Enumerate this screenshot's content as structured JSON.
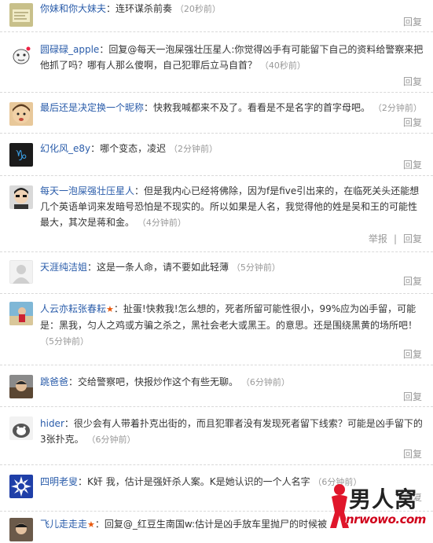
{
  "comments": [
    {
      "user": "你妹和你大妹夫",
      "text": "：连环谋杀前奏",
      "time": "（20秒前）",
      "actions": [
        "回复"
      ]
    },
    {
      "user": "圆碌碌_apple",
      "text": "：回复@每天一泡屎强壮压星人:你觉得凶手有可能留下自己的资料给警察来把他抓了吗？哪有人那么傻啊，自己犯罪后立马自首？",
      "time": "（40秒前）",
      "actions": [
        "回复"
      ]
    },
    {
      "user": "最后还是决定换一个昵称",
      "text": "：快救我喊都来不及了。看看是不是名字的首字母吧。",
      "time": "（2分钟前）",
      "actions": [
        "回复"
      ]
    },
    {
      "user": "幻化风_e8y",
      "text": "：哪个变态，凌迟",
      "time": "（2分钟前）",
      "actions": [
        "回复"
      ]
    },
    {
      "user": "每天一泡屎强壮压星人",
      "text": "：但是我内心已经将佛除，因为f是five引出来的，在临死关头还能想几个英语单词来发暗号恐怕是不现实的。所以如果是人名，我觉得他的姓是吴和王的可能性最大，其次是蒋和金。",
      "time": "（4分钟前）",
      "actions": [
        "举报",
        "回复"
      ]
    },
    {
      "user": "天涯纯洁姐",
      "text": "：这是一条人命，请不要如此轻薄",
      "time": "（5分钟前）",
      "actions": [
        "回复"
      ]
    },
    {
      "user": "人云亦耘张春耘",
      "text": "：扯蛋!快救我!怎么想的，死者所留可能性很小，99%应为凶手留，可能是：黑我，匀人之鸡或方骗之杀之，黑社会老大或黑王。的意思。还是围绕黑黄的场所吧！",
      "time": "（5分钟前）",
      "actions": [
        "回复"
      ]
    },
    {
      "user": "跳爸爸",
      "text": "：交给警察吧，快报炒作这个有些无聊。",
      "time": "（6分钟前）",
      "actions": [
        "回复"
      ]
    },
    {
      "user": "hider",
      "text": "：很少会有人带着扑克出街的，而且犯罪者没有发现死者留下线索？可能是凶手留下的3张扑克。",
      "time": "（6分钟前）",
      "actions": [
        "回复"
      ]
    },
    {
      "user": "四明老叟",
      "text": "：K奸 我，估计是强奸杀人案。K是她认识的一个人名字",
      "time": "（6分钟前）",
      "actions": [
        "回复"
      ]
    },
    {
      "user": "飞儿走走走",
      "text": "：回复@_红豆生南国w:估计是凶手放车里抛尸的时候被",
      "time": "",
      "actions": []
    }
  ],
  "watermark": {
    "name": "男人窝",
    "url": "nrwowo.com"
  }
}
